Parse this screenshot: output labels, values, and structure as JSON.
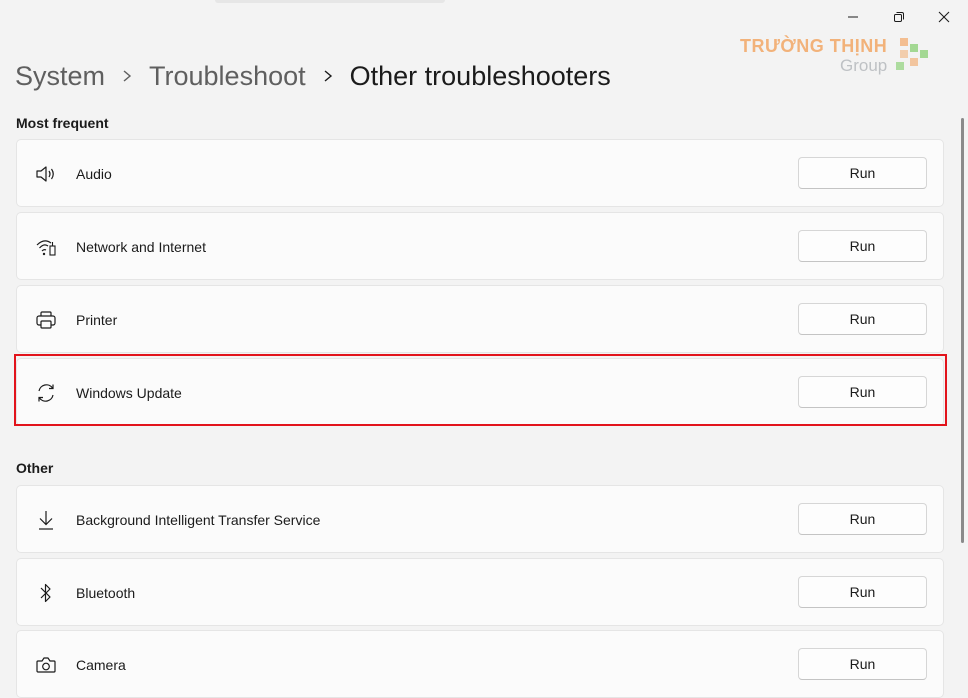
{
  "window": {
    "controls": {
      "minimize": "minimize-icon",
      "restore": "restore-icon",
      "close": "close-icon"
    }
  },
  "watermark": {
    "brand": "TRƯỜNG THỊNH",
    "sub": "Group",
    "color": "#f2a766"
  },
  "breadcrumb": {
    "items": [
      "System",
      "Troubleshoot"
    ],
    "current": "Other troubleshooters",
    "separator_icon": "chevron-right-icon"
  },
  "sections": {
    "frequent": {
      "label": "Most frequent",
      "items": [
        {
          "label": "Audio",
          "icon": "speaker-icon",
          "button": "Run"
        },
        {
          "label": "Network and Internet",
          "icon": "network-icon",
          "button": "Run"
        },
        {
          "label": "Printer",
          "icon": "printer-icon",
          "button": "Run"
        },
        {
          "label": "Windows Update",
          "icon": "sync-icon",
          "button": "Run",
          "highlighted": true
        }
      ]
    },
    "other": {
      "label": "Other",
      "items": [
        {
          "label": "Background Intelligent Transfer Service",
          "icon": "download-icon",
          "button": "Run"
        },
        {
          "label": "Bluetooth",
          "icon": "bluetooth-icon",
          "button": "Run"
        },
        {
          "label": "Camera",
          "icon": "camera-icon",
          "button": "Run"
        }
      ]
    }
  },
  "colors": {
    "highlight": "#e2131b",
    "background": "#f3f3f3",
    "card": "#fbfbfb"
  }
}
